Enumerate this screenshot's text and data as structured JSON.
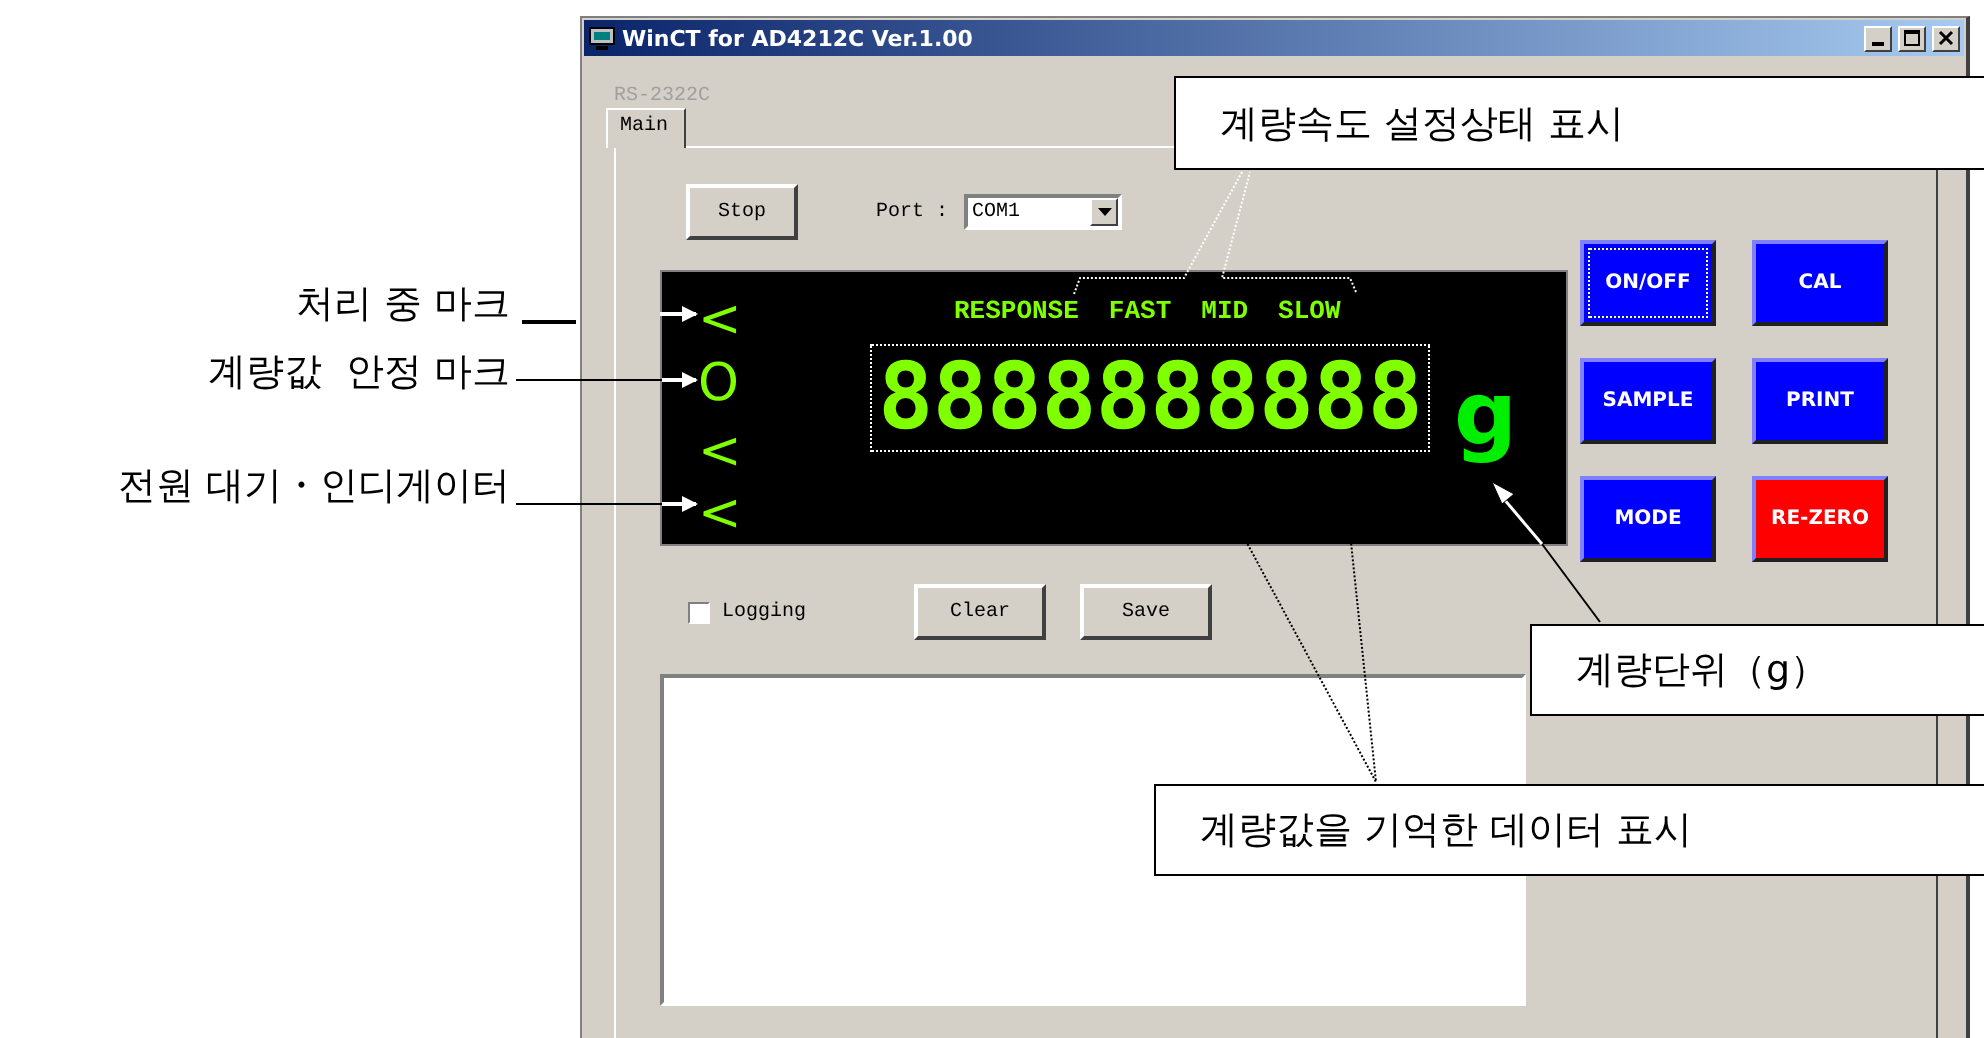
{
  "window": {
    "title": "WinCT for AD4212C Ver.1.00",
    "menu": [
      {
        "label": "RS-2322C",
        "disabled": true
      }
    ],
    "tabs": [
      {
        "label": "Main",
        "selected": true
      }
    ],
    "stop_button": "Stop",
    "port": {
      "label": "Port :",
      "value": "COM1"
    },
    "display": {
      "marks": [
        {
          "symbol": "<"
        },
        {
          "symbol": "O"
        },
        {
          "symbol": "<"
        },
        {
          "symbol": "<"
        }
      ],
      "response_label": "RESPONSE",
      "speeds": [
        "FAST",
        "MID",
        "SLOW"
      ],
      "reading": "8888888888",
      "unit": "g"
    },
    "keys": [
      {
        "label": "ON/OFF",
        "color": "#0000ff",
        "focused": true
      },
      {
        "label": "CAL",
        "color": "#0000ff",
        "focused": false
      },
      {
        "label": "SAMPLE",
        "color": "#0000ff",
        "focused": false
      },
      {
        "label": "PRINT",
        "color": "#0000ff",
        "focused": false
      },
      {
        "label": "MODE",
        "color": "#0000ff",
        "focused": false
      },
      {
        "label": "RE-ZERO",
        "color": "#ff0000",
        "focused": false
      }
    ],
    "logging": {
      "label": "Logging",
      "checked": false
    },
    "log_buttons": [
      "Clear",
      "Save"
    ]
  },
  "annotations": {
    "left": [
      "처리 중 마크",
      "계량값  안정 마크",
      "전원 대기・인디게이터"
    ],
    "callouts": [
      "계량속도 설정상태 표시",
      "계량단위（g）",
      "계량값을 기억한 데이터 표시"
    ]
  }
}
